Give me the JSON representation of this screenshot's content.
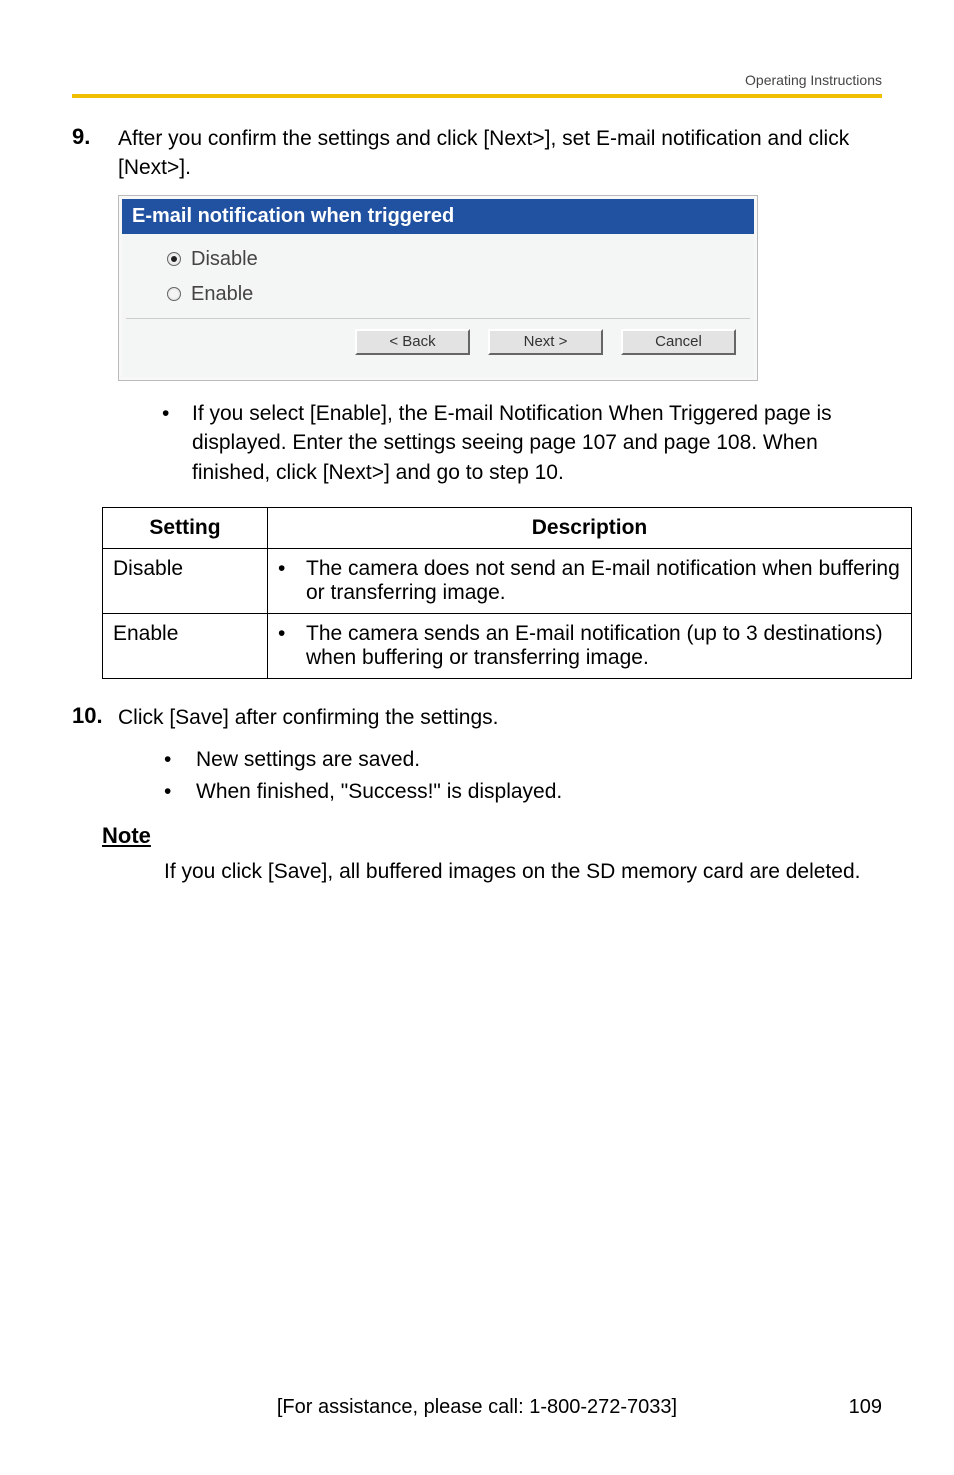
{
  "header": {
    "doc_title": "Operating Instructions"
  },
  "step9": {
    "number": "9.",
    "text": "After you confirm the settings and click [Next>], set E-mail notification and click [Next>]."
  },
  "dialog": {
    "title": "E-mail notification when triggered",
    "option_disable": "Disable",
    "option_enable": "Enable",
    "btn_back": "< Back",
    "btn_next": "Next >",
    "btn_cancel": "Cancel"
  },
  "explain_bullet": "If you select [Enable], the E-mail Notification When Triggered page is displayed. Enter the settings seeing page 107 and page 108. When finished, click [Next>] and go to step 10.",
  "table": {
    "head_setting": "Setting",
    "head_description": "Description",
    "rows": [
      {
        "setting": "Disable",
        "desc": "The camera does not send an E-mail notification when buffering or transferring image."
      },
      {
        "setting": "Enable",
        "desc": "The camera sends an E-mail notification (up to 3 destinations) when buffering or transferring image."
      }
    ]
  },
  "step10": {
    "number": "10.",
    "text": "Click [Save] after confirming the settings.",
    "sub1": "New settings are saved.",
    "sub2": "When finished, \"Success!\" is displayed."
  },
  "note": {
    "heading": "Note",
    "text": "If you click [Save], all buffered images on the SD memory card are deleted."
  },
  "footer": {
    "assist": "[For assistance, please call: 1-800-272-7033]",
    "page": "109"
  }
}
